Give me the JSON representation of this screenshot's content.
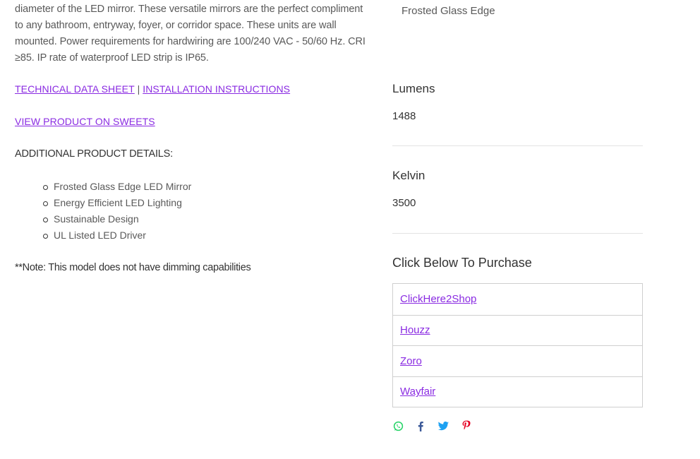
{
  "description": "diameter of the LED mirror. These versatile mirrors are the perfect compliment to any bathroom, entryway, foyer, or corridor space. These units are wall mounted. Power requirements for hardwiring are 100/240 VAC - 50/60 Hz. CRI ≥85. IP rate of waterproof LED strip is IP65.",
  "links": {
    "technical_data_sheet": "TECHNICAL DATA SHEET",
    "separator": "|",
    "installation_instructions": "INSTALLATION INSTRUCTIONS",
    "view_on_sweets": "VIEW PRODUCT ON SWEETS"
  },
  "additional_details": {
    "heading": "ADDITIONAL PRODUCT DETAILS:",
    "items": [
      "Frosted Glass Edge LED Mirror",
      "Energy Efficient LED Lighting",
      "Sustainable Design",
      "UL Listed LED Driver"
    ]
  },
  "note": "**Note: This model does not have dimming capabilities",
  "product_options": {
    "edge_value": "Frosted Glass Edge",
    "lumens": {
      "label": "Lumens",
      "value": "1488"
    },
    "kelvin": {
      "label": "Kelvin",
      "value": "3500"
    }
  },
  "purchase": {
    "title": "Click Below To Purchase",
    "retailers": [
      "ClickHere2Shop",
      "Houzz",
      "Zoro",
      "Wayfair"
    ]
  },
  "share_icons": [
    "whatsapp-icon",
    "facebook-icon",
    "twitter-icon",
    "pinterest-icon"
  ],
  "colors": {
    "link": "#8a2be2",
    "whatsapp": "#25d366",
    "facebook": "#3b5998",
    "twitter": "#1da1f2",
    "pinterest": "#e60023"
  }
}
